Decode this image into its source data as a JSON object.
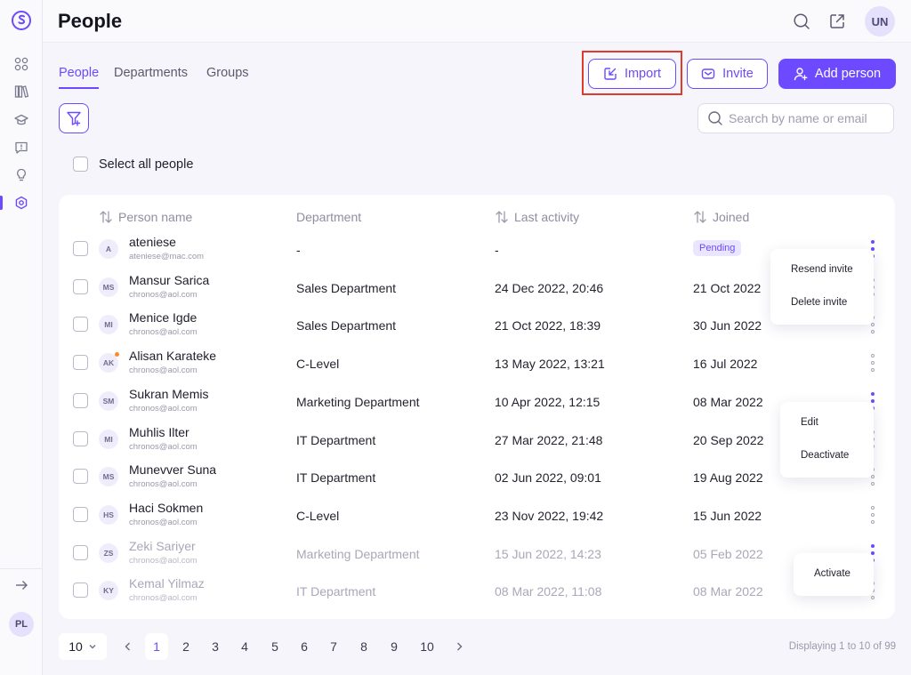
{
  "header": {
    "title": "People",
    "user_initials": "UN"
  },
  "sidebar": {
    "user_initials": "PL",
    "items": [
      "grid-icon",
      "library-icon",
      "graduation-cap-icon",
      "feedback-icon",
      "lightbulb-icon",
      "settings-icon"
    ]
  },
  "tabs": [
    {
      "label": "People",
      "active": true
    },
    {
      "label": "Departments",
      "active": false
    },
    {
      "label": "Groups",
      "active": false
    }
  ],
  "actions": {
    "import_label": "Import",
    "invite_label": "Invite",
    "add_person_label": "Add person"
  },
  "search": {
    "placeholder": "Search by name or email"
  },
  "select_all_label": "Select all people",
  "table": {
    "columns": {
      "name": "Person name",
      "department": "Department",
      "last_activity": "Last activity",
      "joined": "Joined"
    },
    "rows": [
      {
        "initials": "A",
        "name": "ateniese",
        "email": "ateniese@mac.com",
        "department": "-",
        "last_activity": "-",
        "joined": "Pending",
        "pending": true,
        "dim": false,
        "online": false,
        "kebab_active": true
      },
      {
        "initials": "MS",
        "name": "Mansur Sarica",
        "email": "chronos@aol.com",
        "department": "Sales Department",
        "last_activity": "24 Dec 2022, 20:46",
        "joined": "21 Oct 2022",
        "pending": false,
        "dim": false,
        "online": false,
        "kebab_active": false
      },
      {
        "initials": "MI",
        "name": "Menice Igde",
        "email": "chronos@aol.com",
        "department": "Sales Department",
        "last_activity": "21 Oct 2022, 18:39",
        "joined": "30 Jun 2022",
        "pending": false,
        "dim": false,
        "online": false,
        "kebab_active": false
      },
      {
        "initials": "AK",
        "name": "Alisan Karateke",
        "email": "chronos@aol.com",
        "department": "C-Level",
        "last_activity": "13 May 2022, 13:21",
        "joined": "16 Jul 2022",
        "pending": false,
        "dim": false,
        "online": true,
        "kebab_active": false
      },
      {
        "initials": "SM",
        "name": "Sukran Memis",
        "email": "chronos@aol.com",
        "department": "Marketing Department",
        "last_activity": "10 Apr 2022, 12:15",
        "joined": "08 Mar 2022",
        "pending": false,
        "dim": false,
        "online": false,
        "kebab_active": true
      },
      {
        "initials": "MI",
        "name": "Muhlis Ilter",
        "email": "chronos@aol.com",
        "department": "IT Department",
        "last_activity": "27 Mar 2022, 21:48",
        "joined": "20 Sep 2022",
        "pending": false,
        "dim": false,
        "online": false,
        "kebab_active": false
      },
      {
        "initials": "MS",
        "name": "Munevver Suna",
        "email": "chronos@aol.com",
        "department": "IT Department",
        "last_activity": "02 Jun 2022, 09:01",
        "joined": "19 Aug 2022",
        "pending": false,
        "dim": false,
        "online": false,
        "kebab_active": false
      },
      {
        "initials": "HS",
        "name": "Haci Sokmen",
        "email": "chronos@aol.com",
        "department": "C-Level",
        "last_activity": "23 Nov 2022, 19:42",
        "joined": "15 Jun 2022",
        "pending": false,
        "dim": false,
        "online": false,
        "kebab_active": false
      },
      {
        "initials": "ZS",
        "name": "Zeki Sariyer",
        "email": "chronos@aol.com",
        "department": "Marketing Department",
        "last_activity": "15 Jun 2022, 14:23",
        "joined": "05 Feb 2022",
        "pending": false,
        "dim": true,
        "online": false,
        "kebab_active": true
      },
      {
        "initials": "KY",
        "name": "Kemal Yilmaz",
        "email": "chronos@aol.com",
        "department": "IT Department",
        "last_activity": "08 Mar 2022, 11:08",
        "joined": "08 Mar 2022",
        "pending": false,
        "dim": true,
        "online": false,
        "kebab_active": false
      }
    ]
  },
  "menus": {
    "pending": [
      "Resend invite",
      "Delete invite"
    ],
    "active": [
      "Edit",
      "Deactivate"
    ],
    "inactive": [
      "Activate"
    ]
  },
  "pagination": {
    "page_size": "10",
    "pages": [
      "1",
      "2",
      "3",
      "4",
      "5",
      "6",
      "7",
      "8",
      "9",
      "10"
    ],
    "current_page": "1",
    "displaying": "Displaying 1 to 10 of 99"
  },
  "colors": {
    "accent": "#6d4aff",
    "highlight": "#e13a2a",
    "online_dot": "#ff8a2b"
  }
}
